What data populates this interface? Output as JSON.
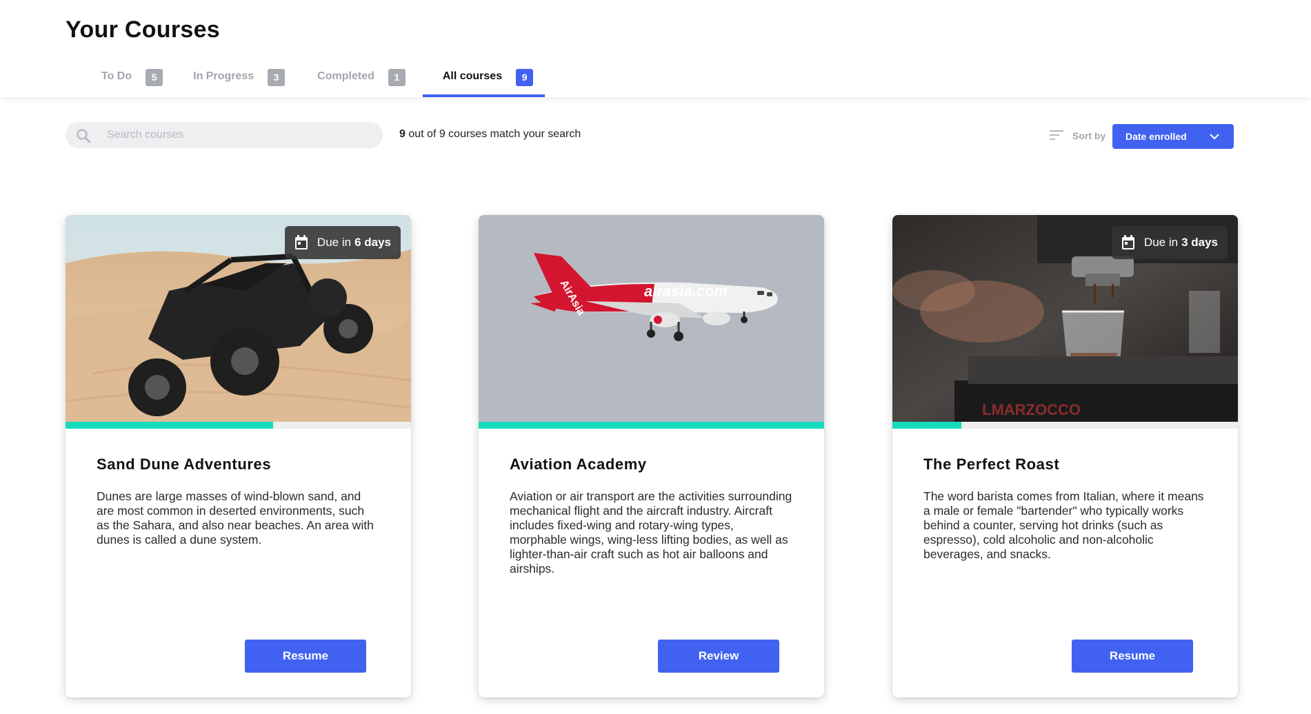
{
  "page": {
    "title": "Your Courses"
  },
  "tabs": [
    {
      "label": "To Do",
      "count": "5",
      "active": false
    },
    {
      "label": "In Progress",
      "count": "3",
      "active": false
    },
    {
      "label": "Completed",
      "count": "1",
      "active": false
    },
    {
      "label": "All courses",
      "count": "9",
      "active": true
    }
  ],
  "toolbar": {
    "search_placeholder": "Search courses",
    "search_value": "",
    "match_count": "9",
    "match_text": " out of 9 courses match your search",
    "sort_label": "Sort by",
    "sort_value": "Date enrolled"
  },
  "colors": {
    "accent": "#4162f1",
    "progress": "#17dbbd",
    "tab_inactive": "#a2a6ac"
  },
  "courses": [
    {
      "title": "Sand Dune Adventures",
      "description": "Dunes are large masses of wind-blown sand, and are most common in deserted environments, such as the Sahara, and also near beaches. An area with dunes is called a dune system.",
      "due_prefix": "Due in",
      "due_value": "6 days",
      "progress_fraction": 0.6,
      "button_label": "Resume",
      "image_subject": "buggy-on-sand-dunes"
    },
    {
      "title": "Aviation Academy",
      "description": "Aviation or air transport are the activities surrounding mechanical flight and the aircraft industry. Aircraft includes fixed-wing and rotary-wing types, morphable wings, wing-less lifting bodies, as well as lighter-than-air craft such as hot air balloons and airships.",
      "due_prefix": "",
      "due_value": "",
      "progress_fraction": 1.0,
      "button_label": "Review",
      "image_subject": "airplane-in-sky",
      "image_livery_text": "airasia.com"
    },
    {
      "title": "The Perfect Roast",
      "description": "The word barista comes from Italian, where it means a male or female \"bartender\" who typically works behind a counter, serving hot drinks (such as espresso), cold alcoholic and non-alcoholic beverages, and snacks.",
      "due_prefix": "Due in",
      "due_value": "3 days",
      "progress_fraction": 0.2,
      "button_label": "Resume",
      "image_subject": "espresso-machine-shot-glass"
    }
  ]
}
